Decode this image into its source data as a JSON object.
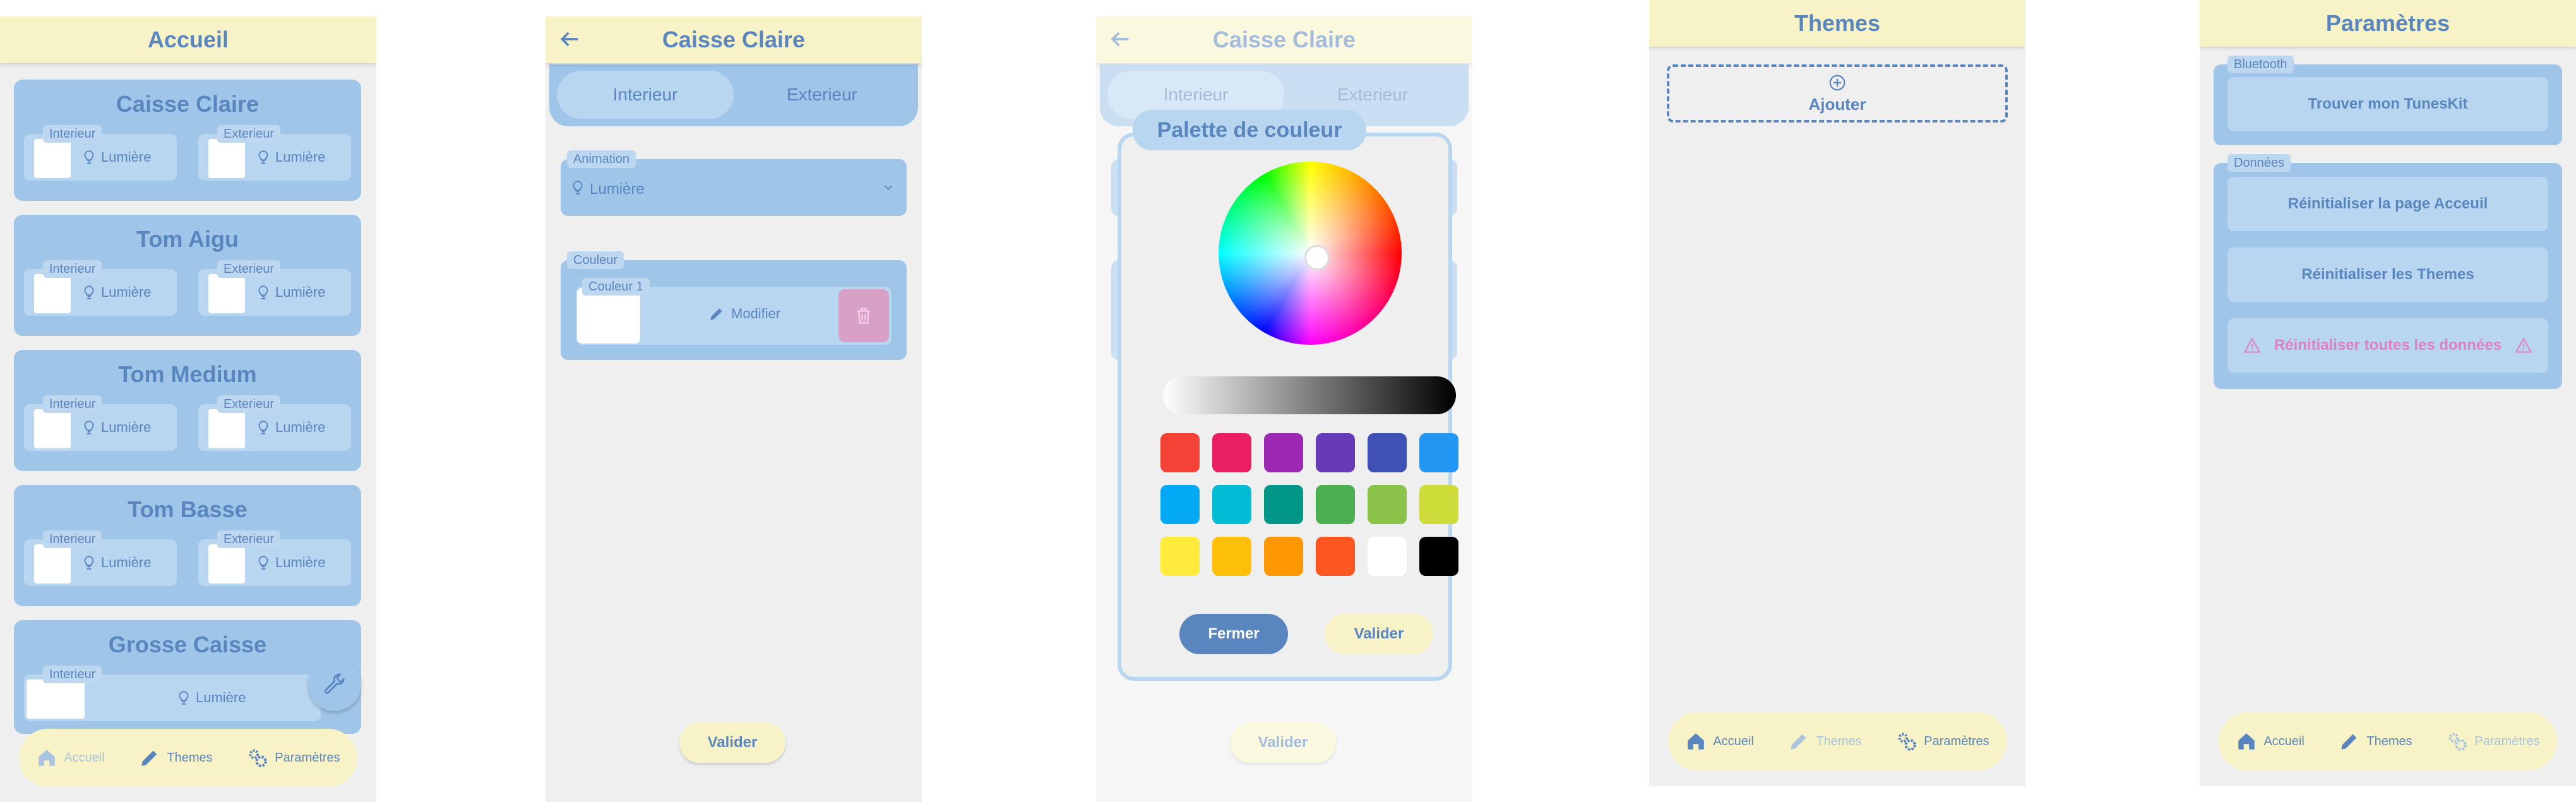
{
  "accueil": {
    "title": "Accueil",
    "drums": [
      {
        "name": "Caisse Claire",
        "interieur": "Interieur",
        "exterieur": "Exterieur",
        "light": "Lumière"
      },
      {
        "name": "Tom Aigu",
        "interieur": "Interieur",
        "exterieur": "Exterieur",
        "light": "Lumière"
      },
      {
        "name": "Tom Medium",
        "interieur": "Interieur",
        "exterieur": "Exterieur",
        "light": "Lumière"
      },
      {
        "name": "Tom Basse",
        "interieur": "Interieur",
        "exterieur": "Exterieur",
        "light": "Lumière"
      },
      {
        "name": "Grosse Caisse",
        "interieur": "Interieur",
        "light": "Lumière"
      }
    ],
    "nav": {
      "accueil": "Accueil",
      "themes": "Themes",
      "parametres": "Paramètres"
    },
    "fab_icon": "wrench-icon"
  },
  "caisse": {
    "title": "Caisse Claire",
    "tabs": [
      "Interieur",
      "Exterieur"
    ],
    "animation_tag": "Animation",
    "animation_value": "Lumière",
    "couleur_tag": "Couleur",
    "couleur1_tag": "Couleur 1",
    "modifier": "Modifier",
    "valider": "Valider"
  },
  "palette": {
    "bg_title": "Caisse Claire",
    "bg_tabs": [
      "Interieur",
      "Exterieur"
    ],
    "title": "Palette de couleur",
    "colors": [
      "#f44336",
      "#e91e63",
      "#9c27b0",
      "#673ab7",
      "#3f51b5",
      "#2196f3",
      "#03a9f4",
      "#00bcd4",
      "#009688",
      "#4caf50",
      "#8bc34a",
      "#cddc39",
      "#ffeb3b",
      "#ffc107",
      "#ff9800",
      "#ff5722",
      "#ffffff",
      "#000000"
    ],
    "fermer": "Fermer",
    "valider": "Valider",
    "bg_valider": "Valider"
  },
  "themes": {
    "title": "Themes",
    "add": "Ajouter",
    "nav": {
      "accueil": "Accueil",
      "themes": "Themes",
      "parametres": "Paramètres"
    }
  },
  "parametres": {
    "title": "Paramètres",
    "bluetooth_tag": "Bluetooth",
    "find_btn": "Trouver mon TunesKit",
    "donnees_tag": "Données",
    "reset_home": "Réinitialiser la page Acceuil",
    "reset_themes": "Réinitialiser les Themes",
    "reset_all": "Réinitialiser toutes les données",
    "nav": {
      "accueil": "Accueil",
      "themes": "Themes",
      "parametres": "Paramètres"
    }
  },
  "colors": {
    "primary": "#5a86c0",
    "card": "#9fc6e8",
    "light_card": "#b9d6f0",
    "cream": "#f7f3c6",
    "danger": "#e080bf"
  }
}
